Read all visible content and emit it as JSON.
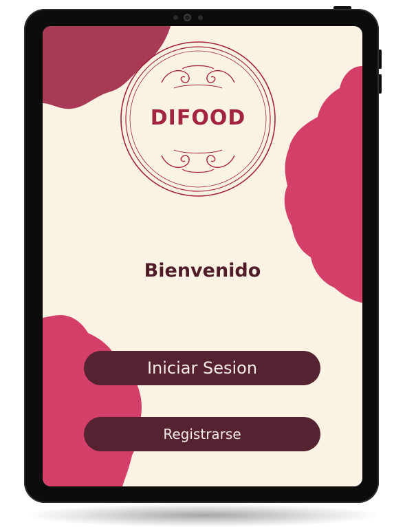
{
  "app": {
    "brand_name": "DIFOOD",
    "welcome_text": "Bienvenido"
  },
  "actions": {
    "login_label": "Iniciar Sesion",
    "register_label": "Registrarse"
  },
  "colors": {
    "background": "#faf2e2",
    "blob_dark": "#a93a55",
    "blob_pink": "#d43f6a",
    "button": "#542230",
    "button_text": "#f6ebe6",
    "brand": "#a3243e",
    "heading": "#4f1d2a"
  },
  "icons": {
    "logo": "ornamental-circle-logo-icon"
  }
}
